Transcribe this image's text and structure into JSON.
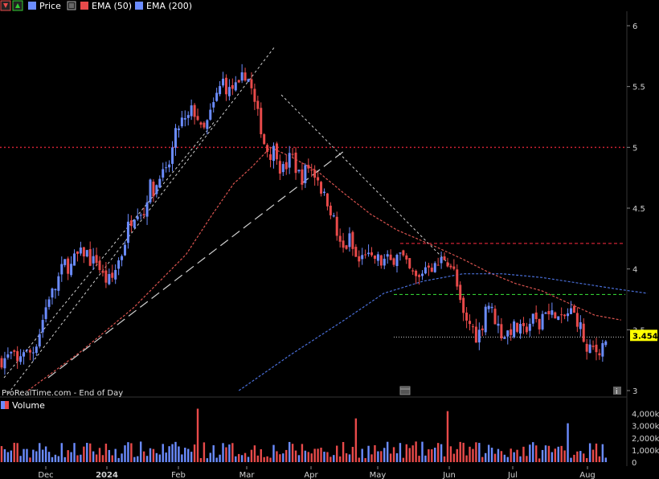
{
  "legend": {
    "price": "Price",
    "ema50": "EMA (50)",
    "ema200": "EMA (200)",
    "volume": "Volume"
  },
  "watermark": "ProRealTime.com - End of Day",
  "last_price": "3.454",
  "icons": [
    "down-arrow-icon",
    "up-arrow-icon",
    "menu-icon",
    "calendar-icon",
    "info-icon"
  ],
  "colors": {
    "up": "#6b8cff",
    "down": "#e84a4a",
    "ema50": "#d9534f",
    "ema200": "#4a6fd9",
    "support": "#33cc33",
    "resistance": "#cc2233",
    "trend": "#d0d0d0",
    "price_tag": "#ffff00"
  },
  "chart_data": {
    "type": "candlestick",
    "title": "",
    "y_ticks": [
      "6",
      "5.5",
      "5",
      "4.5",
      "4",
      "3.5",
      "3"
    ],
    "ylim": [
      3.0,
      6.15
    ],
    "x_ticks": [
      "Dec",
      "2024",
      "Feb",
      "Mar",
      "Apr",
      "May",
      "Jun",
      "Jul",
      "Aug"
    ],
    "price_anchors": [
      [
        0,
        3.25
      ],
      [
        4,
        3.27
      ],
      [
        8,
        3.3
      ],
      [
        12,
        3.22
      ],
      [
        16,
        3.35
      ],
      [
        20,
        3.3
      ],
      [
        24,
        3.33
      ],
      [
        28,
        3.45
      ],
      [
        32,
        3.62
      ],
      [
        36,
        3.78
      ],
      [
        40,
        3.82
      ],
      [
        44,
        3.95
      ],
      [
        48,
        4.05
      ],
      [
        52,
        4.0
      ],
      [
        56,
        4.1
      ],
      [
        60,
        4.12
      ],
      [
        64,
        4.15
      ],
      [
        68,
        4.05
      ],
      [
        72,
        4.08
      ],
      [
        76,
        3.95
      ],
      [
        80,
        3.9
      ],
      [
        84,
        3.92
      ],
      [
        88,
        4.05
      ],
      [
        92,
        4.15
      ],
      [
        96,
        4.35
      ],
      [
        100,
        4.45
      ],
      [
        104,
        4.5
      ],
      [
        108,
        4.45
      ],
      [
        112,
        4.7
      ],
      [
        116,
        4.62
      ],
      [
        120,
        4.8
      ],
      [
        124,
        4.75
      ],
      [
        128,
        4.9
      ],
      [
        132,
        5.1
      ],
      [
        136,
        5.22
      ],
      [
        140,
        5.2
      ],
      [
        144,
        5.3
      ],
      [
        148,
        5.28
      ],
      [
        152,
        5.1
      ],
      [
        156,
        5.2
      ],
      [
        160,
        5.32
      ],
      [
        164,
        5.45
      ],
      [
        168,
        5.55
      ],
      [
        172,
        5.45
      ],
      [
        176,
        5.5
      ],
      [
        180,
        5.48
      ],
      [
        184,
        5.62
      ],
      [
        188,
        5.55
      ],
      [
        192,
        5.35
      ],
      [
        196,
        5.2
      ],
      [
        200,
        5.0
      ],
      [
        204,
        4.95
      ],
      [
        208,
        5.0
      ],
      [
        212,
        4.8
      ],
      [
        216,
        4.85
      ],
      [
        220,
        4.95
      ],
      [
        224,
        4.8
      ],
      [
        228,
        4.75
      ],
      [
        232,
        4.85
      ],
      [
        236,
        4.8
      ],
      [
        240,
        4.75
      ],
      [
        244,
        4.6
      ],
      [
        248,
        4.55
      ],
      [
        252,
        4.4
      ],
      [
        256,
        4.2
      ],
      [
        260,
        4.15
      ],
      [
        264,
        4.25
      ],
      [
        268,
        4.1
      ],
      [
        272,
        4.05
      ],
      [
        276,
        4.15
      ],
      [
        280,
        4.05
      ],
      [
        284,
        4.1
      ],
      [
        288,
        4.05
      ],
      [
        292,
        4.08
      ],
      [
        296,
        4.05
      ],
      [
        300,
        4.15
      ],
      [
        304,
        4.1
      ],
      [
        308,
        4.0
      ],
      [
        312,
        3.95
      ],
      [
        316,
        3.9
      ],
      [
        320,
        4.0
      ],
      [
        324,
        4.05
      ],
      [
        328,
        4.0
      ],
      [
        332,
        4.05
      ],
      [
        336,
        4.1
      ],
      [
        340,
        4.05
      ],
      [
        344,
        3.95
      ],
      [
        348,
        3.7
      ],
      [
        352,
        3.55
      ],
      [
        356,
        3.55
      ],
      [
        360,
        3.45
      ],
      [
        364,
        3.5
      ],
      [
        368,
        3.75
      ],
      [
        372,
        3.65
      ],
      [
        376,
        3.55
      ],
      [
        380,
        3.45
      ],
      [
        384,
        3.48
      ],
      [
        388,
        3.52
      ],
      [
        392,
        3.5
      ],
      [
        396,
        3.48
      ],
      [
        400,
        3.55
      ],
      [
        404,
        3.6
      ],
      [
        408,
        3.52
      ],
      [
        412,
        3.7
      ],
      [
        416,
        3.6
      ],
      [
        420,
        3.65
      ],
      [
        424,
        3.55
      ],
      [
        428,
        3.62
      ],
      [
        432,
        3.65
      ],
      [
        436,
        3.6
      ],
      [
        440,
        3.5
      ],
      [
        444,
        3.3
      ],
      [
        448,
        3.35
      ],
      [
        452,
        3.32
      ],
      [
        456,
        3.38
      ],
      [
        460,
        3.45
      ]
    ],
    "ema50_anchors": [
      [
        20,
        3.0
      ],
      [
        60,
        3.32
      ],
      [
        100,
        3.68
      ],
      [
        140,
        4.12
      ],
      [
        160,
        4.45
      ],
      [
        176,
        4.7
      ],
      [
        190,
        4.84
      ],
      [
        204,
        5.0
      ],
      [
        220,
        4.92
      ],
      [
        240,
        4.8
      ],
      [
        260,
        4.62
      ],
      [
        280,
        4.45
      ],
      [
        300,
        4.32
      ],
      [
        330,
        4.18
      ],
      [
        350,
        4.08
      ],
      [
        370,
        3.97
      ],
      [
        390,
        3.88
      ],
      [
        410,
        3.82
      ],
      [
        430,
        3.72
      ],
      [
        450,
        3.62
      ],
      [
        470,
        3.58
      ]
    ],
    "ema200_anchors": [
      [
        180,
        3.0
      ],
      [
        220,
        3.3
      ],
      [
        260,
        3.58
      ],
      [
        290,
        3.8
      ],
      [
        320,
        3.9
      ],
      [
        350,
        3.96
      ],
      [
        380,
        3.96
      ],
      [
        410,
        3.93
      ],
      [
        440,
        3.88
      ],
      [
        470,
        3.83
      ],
      [
        490,
        3.8
      ]
    ],
    "resistance_line": 5.0,
    "resistance_line2": 4.21,
    "support_line": 3.79,
    "last_line": 3.44,
    "volume_ticks": [
      "4,000k",
      "3,000k",
      "2,000k",
      "1,000k",
      "0"
    ],
    "volume_max": 4500,
    "volume_spikes": [
      [
        148,
        4400
      ],
      [
        268,
        3600
      ],
      [
        339,
        4200
      ],
      [
        430,
        3200
      ]
    ]
  }
}
